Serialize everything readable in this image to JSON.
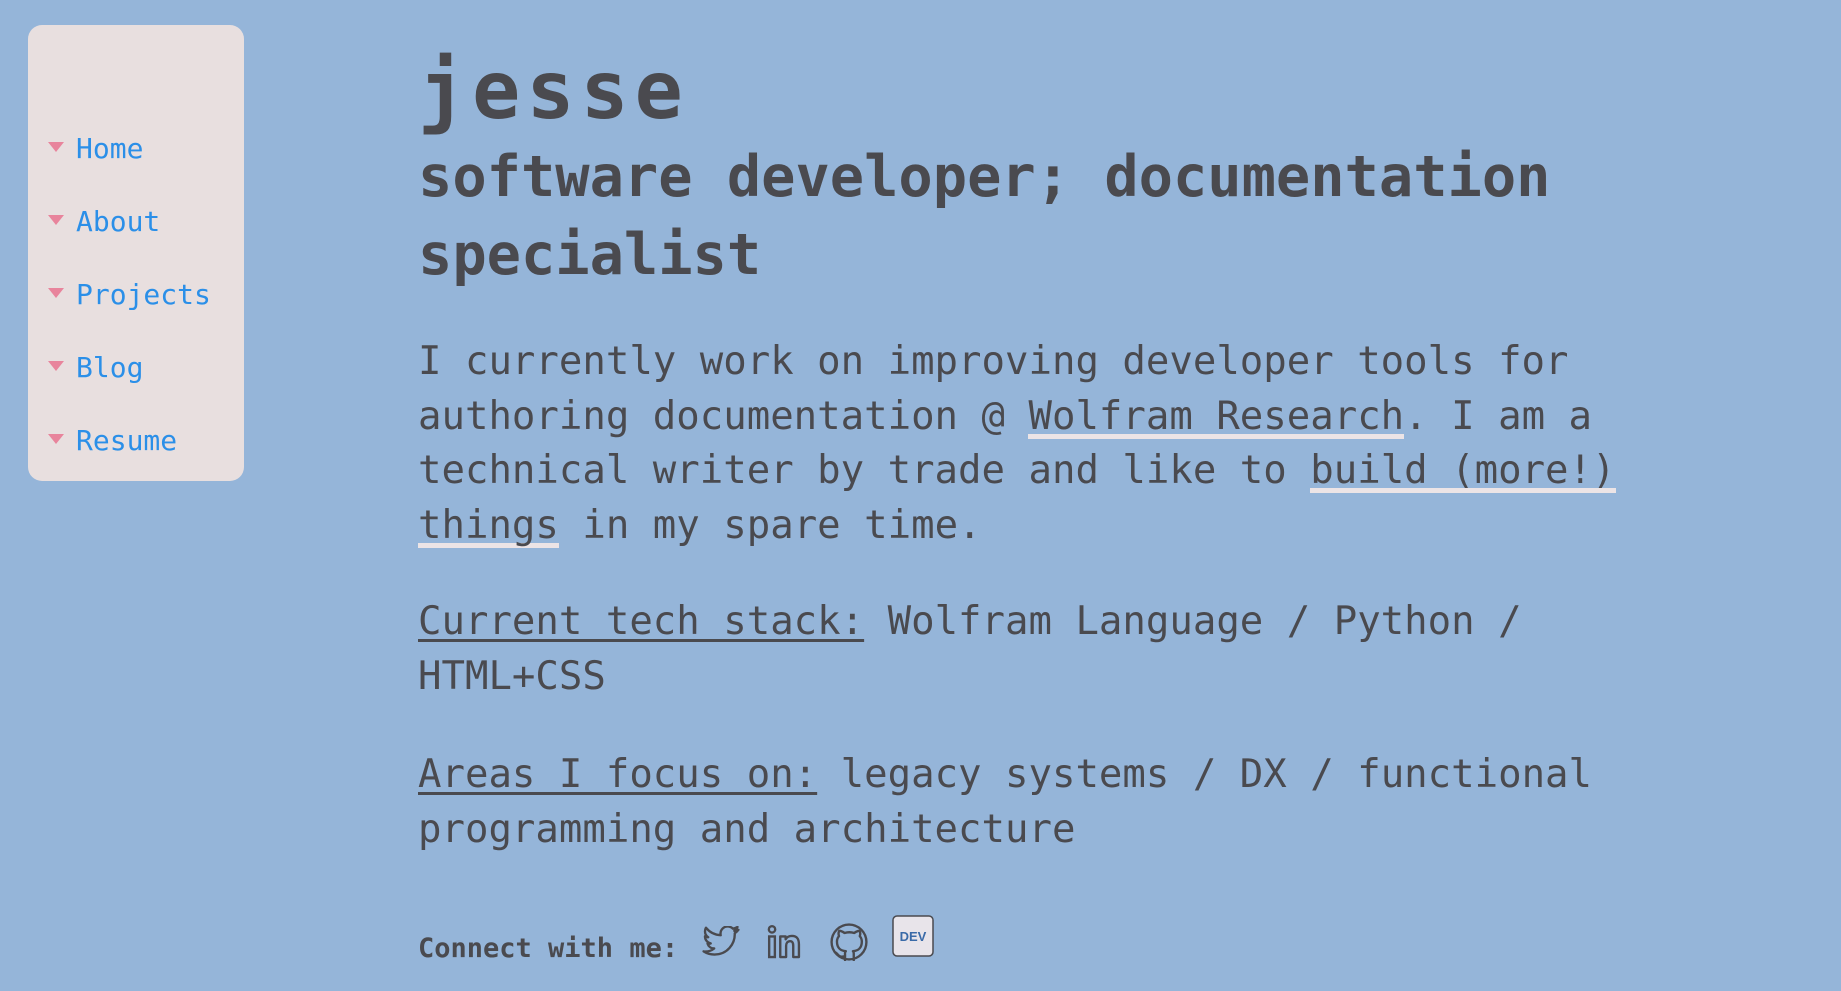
{
  "sidebar": {
    "items": [
      {
        "label": "Home"
      },
      {
        "label": "About"
      },
      {
        "label": "Projects"
      },
      {
        "label": "Blog"
      },
      {
        "label": "Resume"
      }
    ]
  },
  "header": {
    "title": "jesse",
    "subtitle": "software developer; documentation specialist"
  },
  "intro": {
    "text_before_link": "I currently work on improving developer tools for authoring documentation @ ",
    "employer_link": "Wolfram Research",
    "text_middle": ". I am a technical writer by trade and like to ",
    "projects_link": "build (more!) things",
    "text_after": " in my spare time."
  },
  "stack": {
    "label": "Current tech stack:",
    "value": " Wolfram Language / Python / HTML+CSS"
  },
  "focus": {
    "label": "Areas I focus on:",
    "value": " legacy systems / DX / functional programming and architecture"
  },
  "connect": {
    "label": "Connect with me:",
    "icons": [
      "twitter-icon",
      "linkedin-icon",
      "github-icon",
      "dev-icon"
    ],
    "dev_text": "DEV"
  },
  "colors": {
    "background": "#95b5d9",
    "sidebar": "#e8dfdf",
    "nav_link": "#2b8fe8",
    "nav_arrow": "#e8849c",
    "text": "#4a4a4f"
  }
}
